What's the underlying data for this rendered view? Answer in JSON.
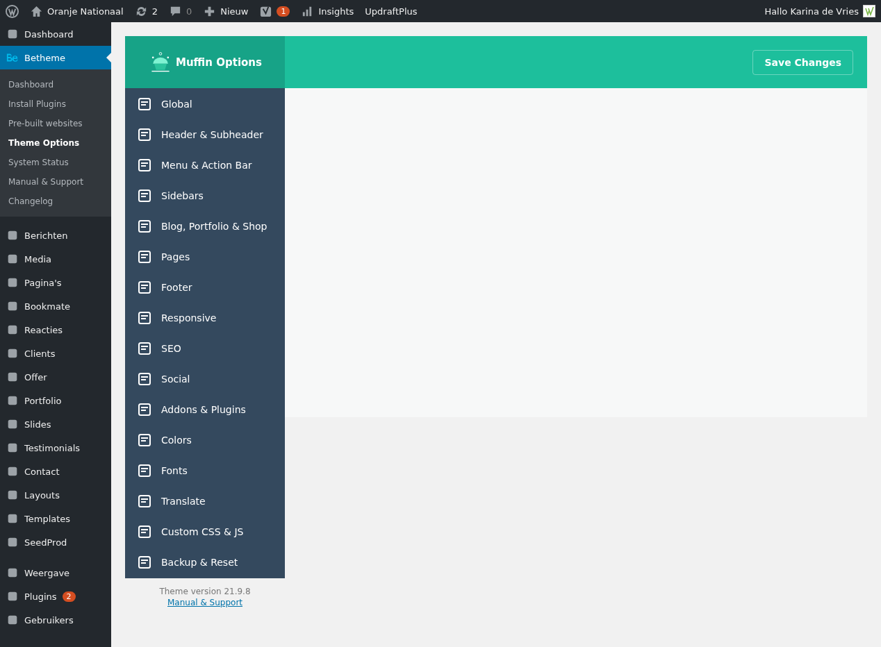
{
  "admin_bar": {
    "site_name": "Oranje Nationaal",
    "updates_count": "2",
    "comments_count": "0",
    "new_label": "Nieuw",
    "seo_badge": "1",
    "insights_label": "Insights",
    "updraft_label": "UpdraftPlus",
    "greeting": "Hallo Karina de Vries"
  },
  "sidebar": {
    "groups": [
      {
        "items": [
          {
            "label": "Dashboard",
            "selected": false
          },
          {
            "label": "Betheme",
            "selected": true,
            "children": [
              {
                "label": "Dashboard",
                "selected": false
              },
              {
                "label": "Install Plugins",
                "selected": false
              },
              {
                "label": "Pre-built websites",
                "selected": false
              },
              {
                "label": "Theme Options",
                "selected": true
              },
              {
                "label": "System Status",
                "selected": false
              },
              {
                "label": "Manual & Support",
                "selected": false
              },
              {
                "label": "Changelog",
                "selected": false
              }
            ]
          }
        ]
      },
      {
        "items": [
          {
            "label": "Berichten",
            "selected": false
          },
          {
            "label": "Media",
            "selected": false
          },
          {
            "label": "Pagina's",
            "selected": false
          },
          {
            "label": "Bookmate",
            "selected": false
          },
          {
            "label": "Reacties",
            "selected": false
          },
          {
            "label": "Clients",
            "selected": false
          },
          {
            "label": "Offer",
            "selected": false
          },
          {
            "label": "Portfolio",
            "selected": false
          },
          {
            "label": "Slides",
            "selected": false
          },
          {
            "label": "Testimonials",
            "selected": false
          },
          {
            "label": "Contact",
            "selected": false
          },
          {
            "label": "Layouts",
            "selected": false
          },
          {
            "label": "Templates",
            "selected": false
          },
          {
            "label": "SeedProd",
            "selected": false
          }
        ]
      },
      {
        "items": [
          {
            "label": "Weergave",
            "selected": false
          },
          {
            "label": "Plugins",
            "selected": false,
            "badge": "2"
          },
          {
            "label": "Gebruikers",
            "selected": false
          }
        ]
      }
    ]
  },
  "options": {
    "title": "Muffin Options",
    "save_button": "Save Changes",
    "menu": [
      {
        "label": "Global",
        "selected": false
      },
      {
        "label": "Header & Subheader",
        "selected": false
      },
      {
        "label": "Menu & Action Bar",
        "selected": false
      },
      {
        "label": "Sidebars",
        "selected": false
      },
      {
        "label": "Blog, Portfolio & Shop",
        "selected": false
      },
      {
        "label": "Pages",
        "selected": false
      },
      {
        "label": "Footer",
        "selected": false
      },
      {
        "label": "Responsive",
        "selected": false
      },
      {
        "label": "SEO",
        "selected": false
      },
      {
        "label": "Social",
        "selected": false
      },
      {
        "label": "Addons & Plugins",
        "selected": false
      },
      {
        "label": "Colors",
        "selected": false
      },
      {
        "label": "Fonts",
        "selected": false
      },
      {
        "label": "Translate",
        "selected": false
      },
      {
        "label": "Custom CSS & JS",
        "selected": false
      },
      {
        "label": "Backup & Reset",
        "selected": false
      }
    ],
    "version": "Theme version 21.9.8",
    "support_link": "Manual & Support"
  }
}
